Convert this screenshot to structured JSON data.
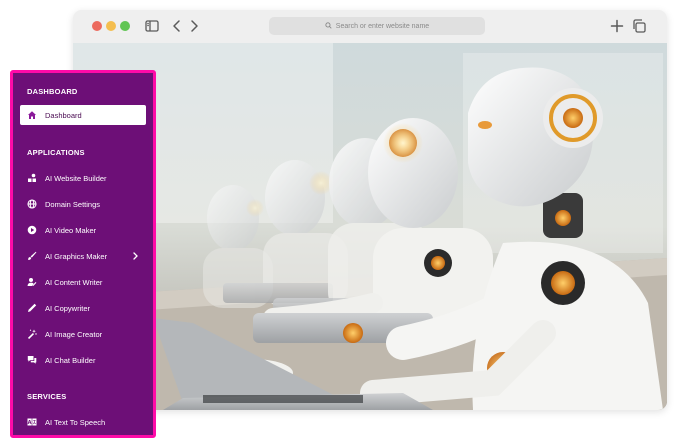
{
  "browser": {
    "url_placeholder": "Search or enter website name",
    "icons": [
      "sidebar-toggle-icon",
      "back-icon",
      "forward-icon",
      "search-icon",
      "new-tab-icon",
      "tabs-overview-icon"
    ]
  },
  "hero": {
    "image_alt": "Humanoid robots typing on laptops"
  },
  "sidebar": {
    "sections": {
      "dashboard": "DASHBOARD",
      "applications": "APPLICATIONS",
      "services": "SERVICES"
    },
    "dashboard_item": {
      "label": "Dashboard",
      "icon": "home-icon"
    },
    "applications": [
      {
        "label": "AI Website Builder",
        "icon": "blocks-icon"
      },
      {
        "label": "Domain Settings",
        "icon": "globe-icon"
      },
      {
        "label": "AI Video Maker",
        "icon": "video-play-icon"
      },
      {
        "label": "AI Graphics Maker",
        "icon": "brush-icon"
      },
      {
        "label": "AI Content Writer",
        "icon": "user-edit-icon"
      },
      {
        "label": "AI Copywriter",
        "icon": "pen-icon"
      },
      {
        "label": "AI Image Creator",
        "icon": "magic-wand-icon"
      },
      {
        "label": "AI Chat Builder",
        "icon": "chat-icon"
      }
    ],
    "services": [
      {
        "label": "AI Text To Speech",
        "icon": "text-speech-icon"
      }
    ]
  },
  "colors": {
    "sidebar_bg": "#6d0f77",
    "sidebar_border": "#ff0aa8",
    "active_item_bg": "#ffffff",
    "traffic_red": "#ec6a5e",
    "traffic_yellow": "#f4be4f",
    "traffic_green": "#61c554"
  }
}
